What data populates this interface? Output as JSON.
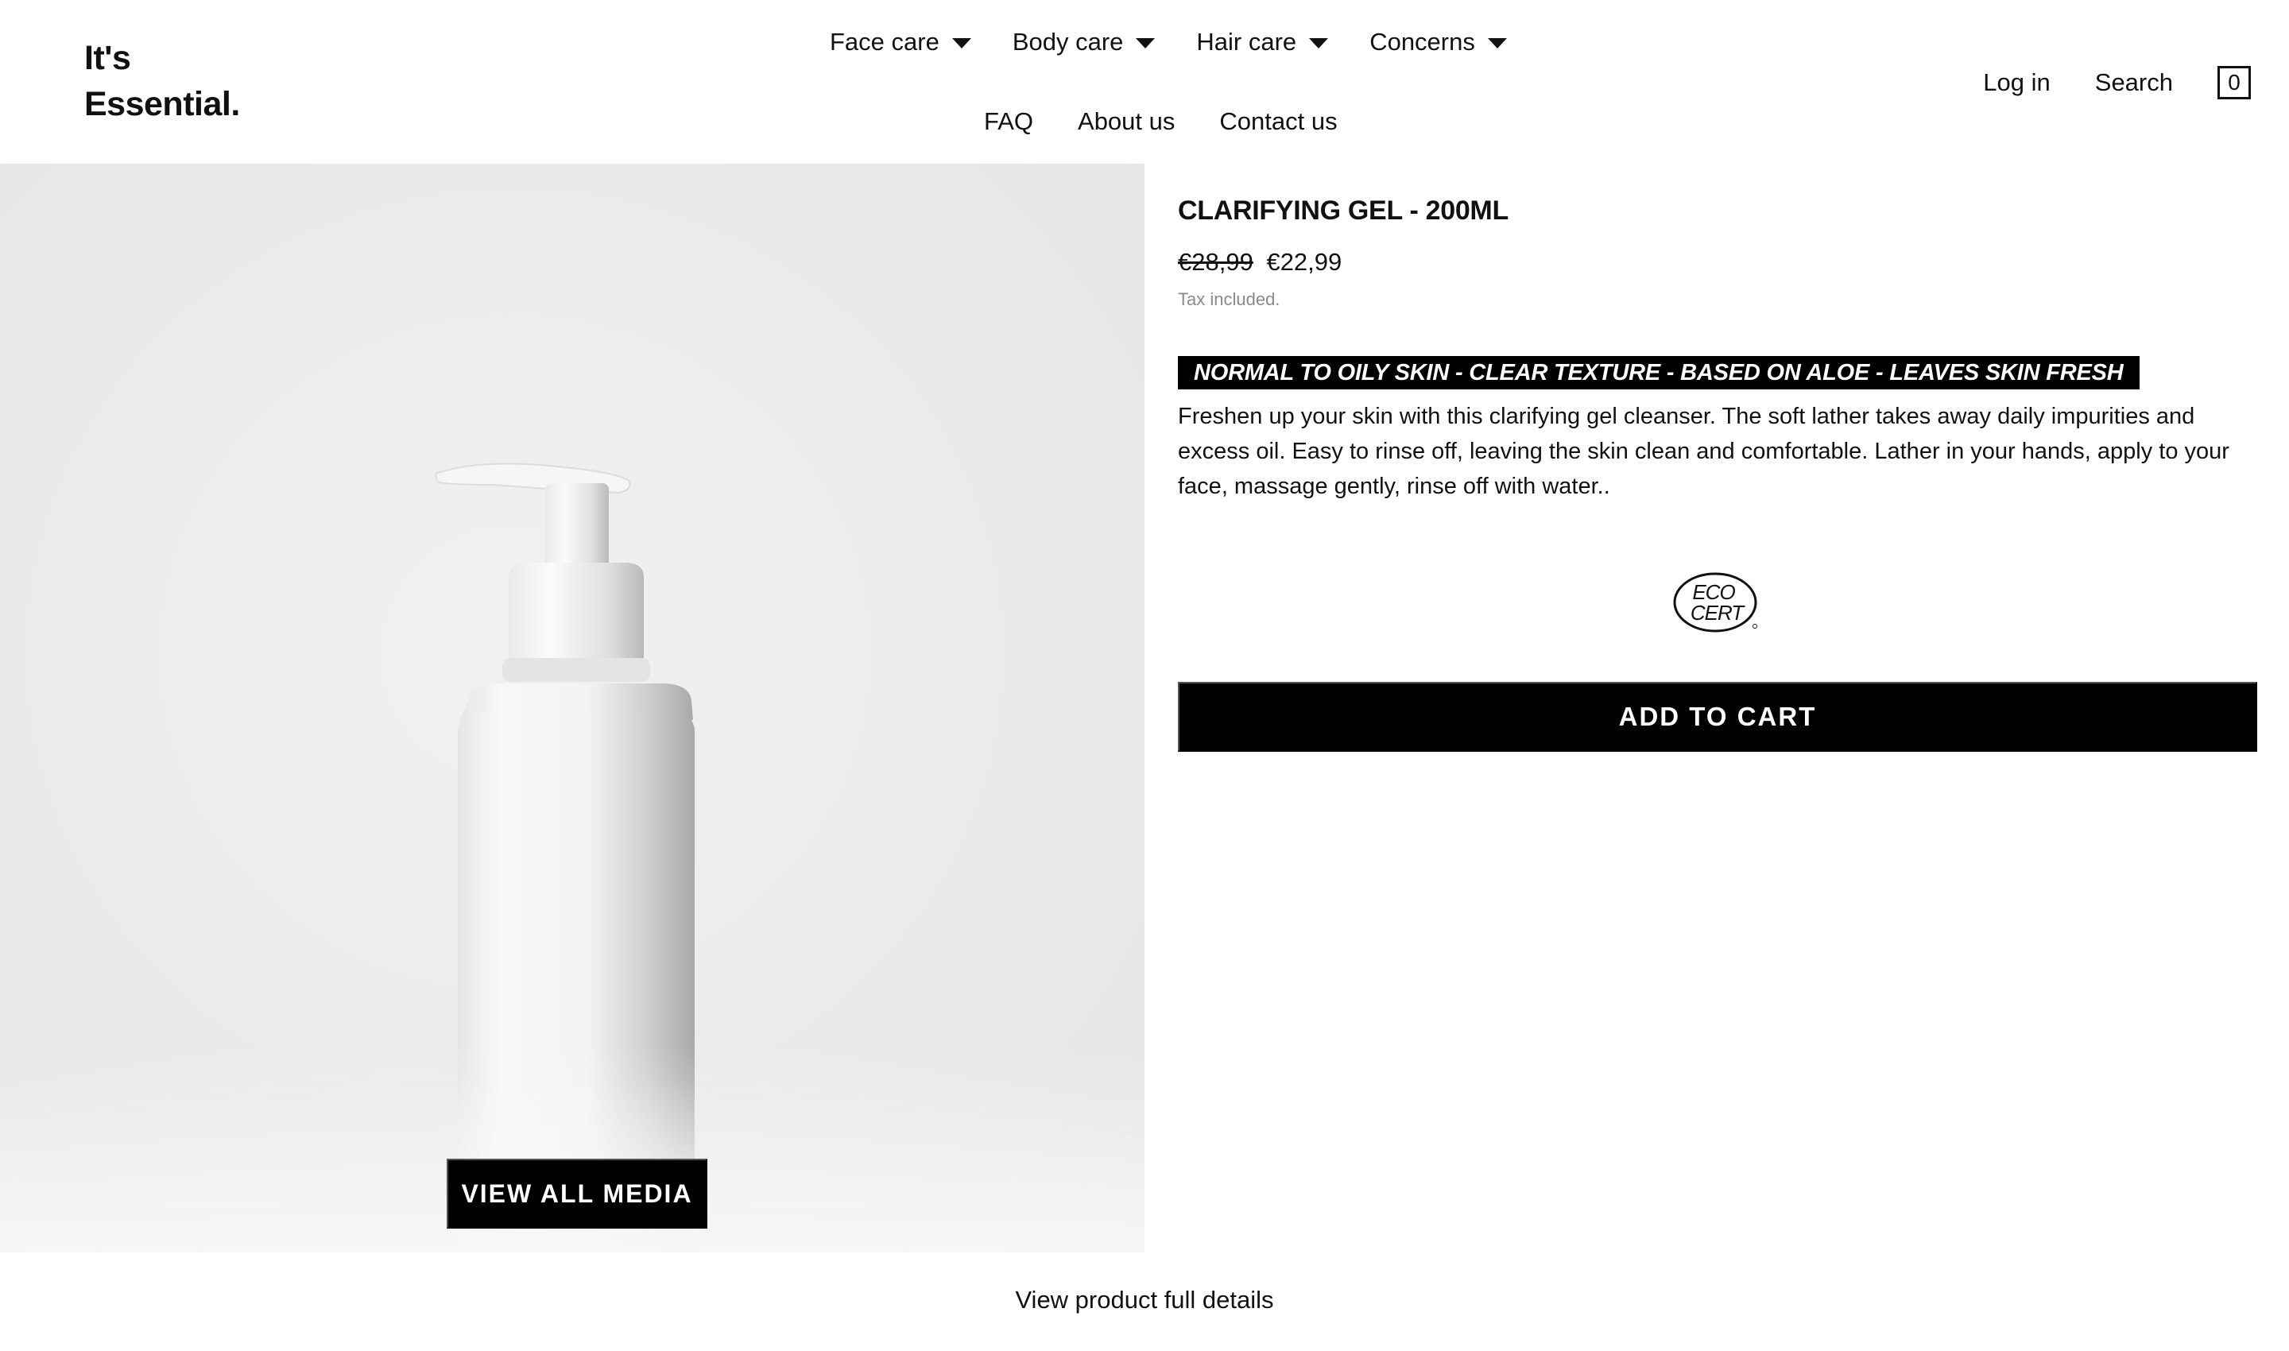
{
  "brand": {
    "logo_line1": "It's",
    "logo_line2": "Essential."
  },
  "nav": {
    "primary": [
      {
        "label": "Face care",
        "has_dropdown": true
      },
      {
        "label": "Body care",
        "has_dropdown": true
      },
      {
        "label": "Hair care",
        "has_dropdown": true
      },
      {
        "label": "Concerns",
        "has_dropdown": true
      }
    ],
    "secondary": [
      {
        "label": "FAQ"
      },
      {
        "label": "About us"
      },
      {
        "label": "Contact us"
      }
    ]
  },
  "header_actions": {
    "login": "Log in",
    "search": "Search",
    "cart_count": "0"
  },
  "media": {
    "view_all_label": "VIEW ALL MEDIA"
  },
  "product": {
    "title": "CLARIFYING GEL - 200ML",
    "price_old": "€28,99",
    "price_new": "€22,99",
    "tax_note": "Tax included.",
    "tagline": "NORMAL TO OILY SKIN - CLEAR TEXTURE - BASED ON ALOE - LEAVES SKIN  FRESH",
    "description": "Freshen up your skin with this clarifying gel cleanser. The soft lather takes away daily impurities and excess oil. Easy to rinse off, leaving the skin clean and comfortable. Lather in your hands, apply to your face, massage gently, rinse off with water..",
    "certification": {
      "line1": "ECO",
      "line2": "CERT"
    },
    "add_to_cart_label": "ADD TO CART"
  },
  "footer_link": "View product full details",
  "colors": {
    "background": "#ffffff",
    "text": "#111111",
    "button_bg": "#000000",
    "button_text": "#ffffff",
    "muted": "#8a8a8a",
    "media_bg": "#ececec"
  }
}
